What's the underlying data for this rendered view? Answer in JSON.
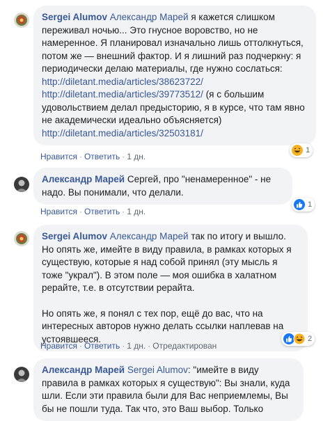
{
  "comments": [
    {
      "author": "Sergei Alumov",
      "body_lines": [
        {
          "type": "text",
          "parts": [
            {
              "k": "mention",
              "t": "Александр Марей"
            },
            {
              "k": "text",
              "t": " я кажется слишком переживал ночью... Это гнусное воровство, но не намеренное. Я планировал изначально лишь оттолкнуться, потом же — внешний фактор. И я лишний раз подчеркну: я периодически делаю материалы, где нужно сослаться:"
            }
          ]
        },
        {
          "type": "link",
          "t": "http://diletant.media/articles/38623722/"
        },
        {
          "type": "text",
          "parts": [
            {
              "k": "link",
              "t": "http://diletant.media/articles/39773512/"
            },
            {
              "k": "text",
              "t": " (я с большим удовольствием делал предысторию, я в курсе, что там явно не академически идеально объясняется)"
            }
          ]
        },
        {
          "type": "link",
          "t": "http://diletant.media/articles/32503181/"
        }
      ],
      "actions": [
        "Нравится",
        "Ответить",
        "1 дн."
      ],
      "reactions": {
        "icons": [
          "haha"
        ],
        "count": "1"
      }
    },
    {
      "author": "Александр Марей",
      "body_text": "Сергей, про \"ненамеренное\" - не надо. Вы понимали, что делали.",
      "actions": [
        "Нравится",
        "Ответить",
        "1 дн."
      ],
      "reactions": {
        "icons": [
          "like"
        ],
        "count": "1"
      }
    },
    {
      "author": "Sergei Alumov",
      "mention": "Александр Марей",
      "para1": " так по итогу и вышло. Но опять же, имейте в виду правила, в рамках которых я существую, которые я над собой принял (эту мысль я тоже \"украл\"). В этом поле — моя ошибка в халатном рерайте, т.е. в отсутствии рерайта.",
      "para2": "Но опять же, я понял с тех пор, ещё до вас, что на интересных авторов нужно делать ссылки наплевав на устоявшееся.",
      "actions": [
        "Нравится",
        "Ответить",
        "1 дн.",
        "Отредактирован"
      ],
      "reactions": {
        "icons": [
          "like",
          "haha"
        ],
        "count": "2"
      }
    },
    {
      "author": "Александр Марей",
      "mention": "Sergei Alumov",
      "body_text": ": \"имейте в виду правила в рамках которых я существую\": Вы знали, куда шли. Если эти правила были для Вас неприемлемы, Вы бы не пошли туда. Так что, это Ваш выбор. Только"
    }
  ],
  "colors": {
    "link": "#385898",
    "bubble": "#f2f3f5",
    "meta": "#606770",
    "like_blue": "#1877f2",
    "haha_yellow": "#f7b125"
  }
}
